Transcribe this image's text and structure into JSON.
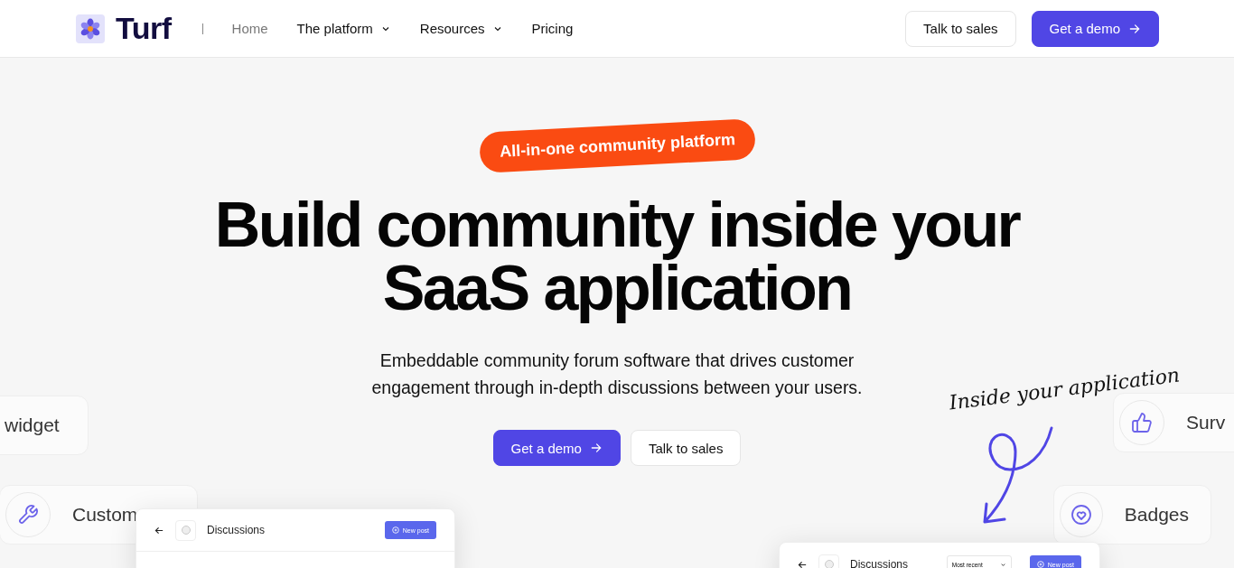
{
  "nav": {
    "brand": "Turf",
    "links": [
      {
        "label": "Home",
        "selected": true,
        "has_menu": false
      },
      {
        "label": "The platform",
        "selected": false,
        "has_menu": true
      },
      {
        "label": "Resources",
        "selected": false,
        "has_menu": true
      },
      {
        "label": "Pricing",
        "selected": false,
        "has_menu": false
      }
    ],
    "secondary_button": "Talk to sales",
    "primary_button": "Get a demo"
  },
  "hero": {
    "badge": "All-in-one community platform",
    "title_lines": [
      "Build community inside your",
      "SaaS application"
    ],
    "subtitle_lines": [
      "Embeddable community forum software that drives customer",
      "engagement through in-depth discussions between your users."
    ],
    "primary_button": "Get a demo",
    "secondary_button": "Talk to sales",
    "handwritten_note": "Inside your application"
  },
  "feature_cards": [
    {
      "label": "widget",
      "kind": "plain"
    },
    {
      "label": "Custom",
      "kind": "wrench"
    },
    {
      "label": "Surv",
      "kind": "thumb"
    },
    {
      "label": "Badges",
      "kind": "heart"
    }
  ],
  "mockups": [
    {
      "title": "Discussions",
      "button": "New post"
    },
    {
      "title": "Discussions",
      "sort": "Most recent",
      "button": "New post"
    }
  ]
}
